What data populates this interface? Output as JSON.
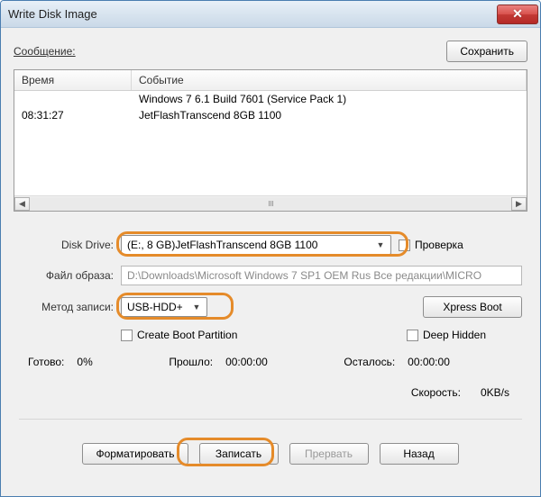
{
  "window": {
    "title": "Write Disk Image"
  },
  "icons": {
    "close": "✕",
    "drop": "▼",
    "left": "◀",
    "right": "▶"
  },
  "top": {
    "message_label": "Сообщение:",
    "save_label": "Сохранить"
  },
  "log": {
    "col_time": "Время",
    "col_event": "Событие",
    "rows": [
      {
        "time": "",
        "event": "Windows 7 6.1 Build 7601 (Service Pack 1)"
      },
      {
        "time": "08:31:27",
        "event": "JetFlashTranscend 8GB  1100"
      }
    ]
  },
  "form": {
    "disk_drive_label": "Disk Drive:",
    "disk_drive_value": "(E:, 8 GB)JetFlashTranscend 8GB  1100",
    "verify_label": "Проверка",
    "image_label": "Файл образа:",
    "image_value": "D:\\Downloads\\Microsoft Windows 7 SP1 OEM Rus Все редакции\\MICRO",
    "method_label": "Метод записи:",
    "method_value": "USB-HDD+",
    "xpress_label": "Xpress Boot",
    "create_boot_label": "Create Boot Partition",
    "deep_hidden_label": "Deep Hidden"
  },
  "status": {
    "ready_label": "Готово:",
    "ready_value": "0%",
    "elapsed_label": "Прошло:",
    "elapsed_value": "00:00:00",
    "remaining_label": "Осталось:",
    "remaining_value": "00:00:00",
    "speed_label": "Скорость:",
    "speed_value": "0KB/s"
  },
  "footer": {
    "format": "Форматировать",
    "write": "Записать",
    "abort": "Прервать",
    "back": "Назад"
  }
}
